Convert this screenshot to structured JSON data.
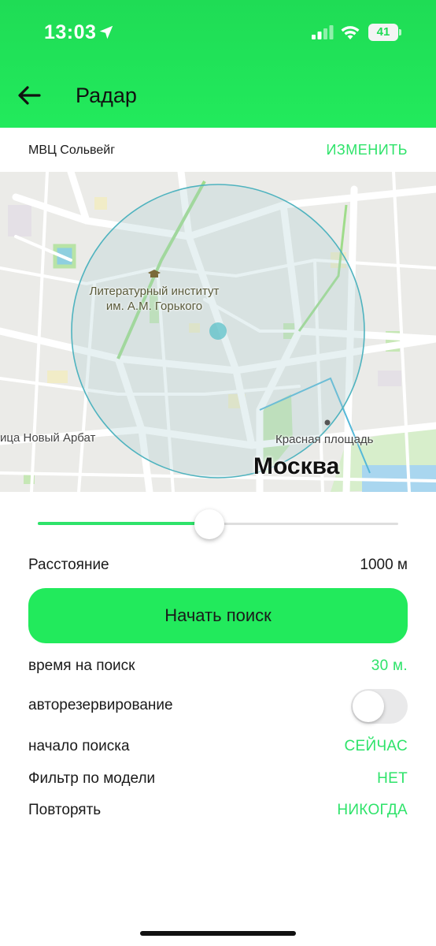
{
  "status_bar": {
    "time": "13:03",
    "battery_level": "41",
    "icons": [
      "location-arrow-icon",
      "signal-icon",
      "wifi-icon",
      "battery-icon"
    ]
  },
  "header": {
    "title": "Радар",
    "back_icon": "arrow-left-icon"
  },
  "location": {
    "name": "МВЦ Сольвейг",
    "change_label": "ИЗМЕНИТЬ"
  },
  "map": {
    "labels": {
      "institute_line1": "Литературный институт",
      "institute_line2": "им. А.М. Горького",
      "arbat": "ица Новый Арбат",
      "square": "Красная площадь",
      "city": "Москва"
    },
    "poi_icon": "graduation-cap-icon"
  },
  "slider": {
    "fraction": 0.475
  },
  "distance": {
    "label": "Расстояние",
    "value": "1000 м"
  },
  "start_button": {
    "label": "Начать поиск"
  },
  "settings": {
    "search_time": {
      "label": "время на поиск",
      "value": "30 м."
    },
    "auto_reserve": {
      "label": "авторезервирование",
      "enabled": false
    },
    "search_start": {
      "label": "начало поиска",
      "value": "СЕЙЧАС"
    },
    "model_filter": {
      "label": "Фильтр по модели",
      "value": "НЕТ"
    },
    "repeat": {
      "label": "Повторять",
      "value": "НИКОГДА"
    }
  },
  "colors": {
    "brand_green": "#22ea5c",
    "accent_text": "#2ee36a",
    "radar_circle": "#4fb3bf"
  }
}
